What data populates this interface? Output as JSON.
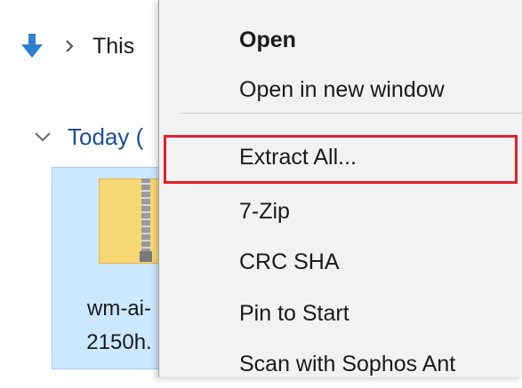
{
  "breadcrumb": {
    "down_arrow_icon": "arrow-down-icon",
    "chevron_icon": "chevron-right-icon",
    "label": "This"
  },
  "group": {
    "chevron_icon": "chevron-down-icon",
    "label": "Today ("
  },
  "file": {
    "icon": "zip-folder-icon",
    "name_line1": "wm-ai-",
    "name_line2": "2150h."
  },
  "context_menu": {
    "items": [
      {
        "label": "Open",
        "bold": true
      },
      {
        "label": "Open in new window",
        "bold": false
      },
      {
        "label": "Extract All...",
        "bold": false,
        "highlighted": true
      },
      {
        "label": "7-Zip",
        "bold": false
      },
      {
        "label": "CRC SHA",
        "bold": false
      },
      {
        "label": "Pin to Start",
        "bold": false
      },
      {
        "label": "Scan with Sophos Ant",
        "bold": false
      }
    ]
  },
  "colors": {
    "accent_blue": "#1e4e96",
    "arrow_blue": "#2f7fd3",
    "selection_bg": "#cce8ff",
    "menu_bg": "#f2f2f2",
    "highlight_red": "#e0202d",
    "zip_yellow": "#f8d775"
  }
}
